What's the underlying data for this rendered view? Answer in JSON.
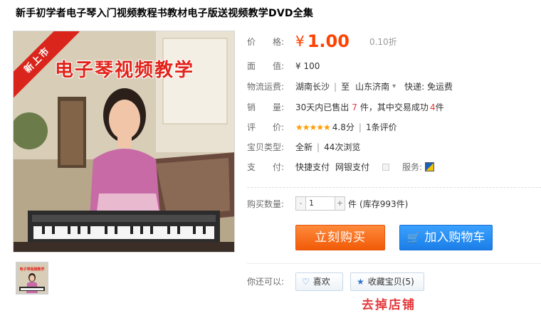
{
  "product": {
    "title": "新手初学者电子琴入门视频教程书教材电子版送视频教学DVD全集",
    "image_ribbon": "新上市",
    "image_caption": "电子琴视频教学",
    "thumb_caption": "电子琴视频教学"
  },
  "price": {
    "label": "价　　格:",
    "symbol": "¥",
    "value": "1.00",
    "discount": "0.10折"
  },
  "face_value": {
    "label": "面　　值:",
    "value": "¥ 100"
  },
  "shipping": {
    "label": "物流运费:",
    "from": "湖南长沙",
    "to_prefix": "至",
    "to": "山东济南",
    "express": "快递: 免运费"
  },
  "sales": {
    "label": "销　　量:",
    "prefix": "30天内已售出",
    "sold": "7",
    "middle": "件，其中交易成功",
    "success": "4",
    "suffix": "件"
  },
  "rating": {
    "label": "评　　价:",
    "stars": "★★★★★",
    "score": "4.8分",
    "count": "1条评价"
  },
  "item_type": {
    "label": "宝贝类型:",
    "condition": "全新",
    "views": "44次浏览"
  },
  "payment": {
    "label": "支　　付:",
    "method1": "快捷支付",
    "method2": "网银支付",
    "service_label": "服务:"
  },
  "quantity": {
    "label": "购买数量:",
    "minus": "-",
    "value": "1",
    "plus": "+",
    "unit": "件",
    "stock": "(库存993件)"
  },
  "actions": {
    "buy_now": "立刻购买",
    "add_to_cart": "加入购物车"
  },
  "extras": {
    "label": "你还可以:",
    "like": "喜欢",
    "favorite": "收藏宝贝",
    "favorite_count": "(5)"
  },
  "shop_link": "去掉店铺"
}
